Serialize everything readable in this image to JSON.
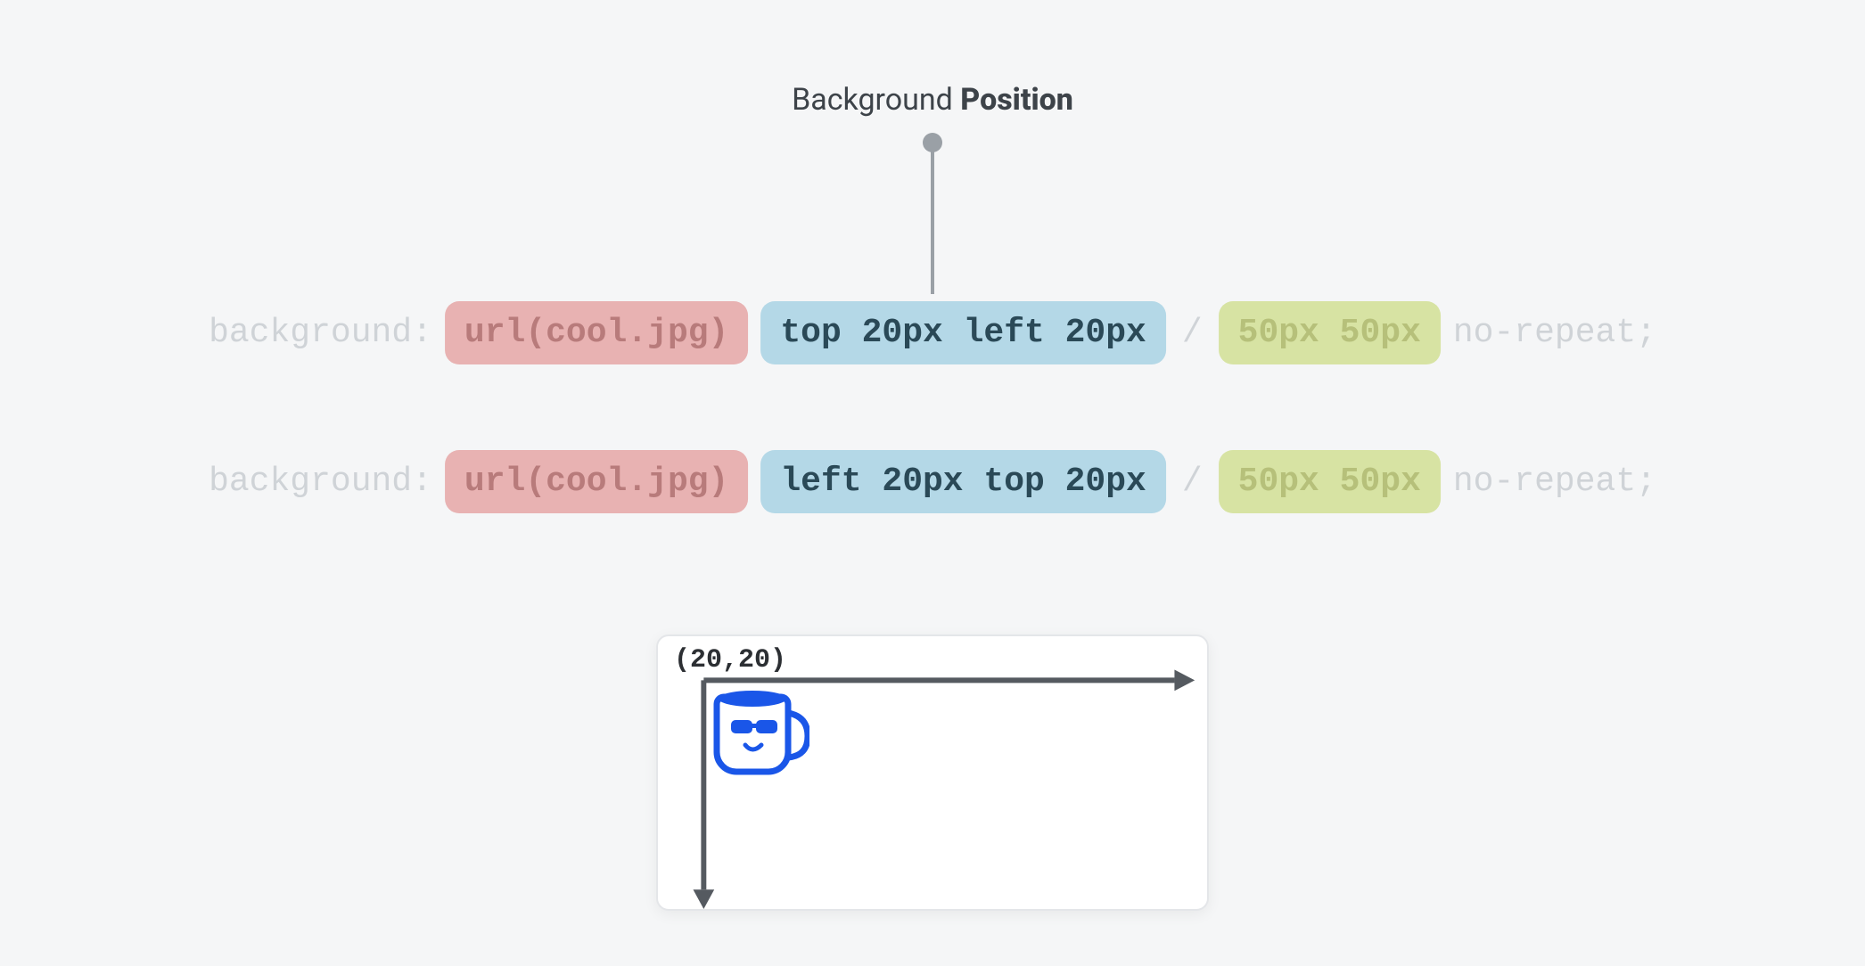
{
  "heading": {
    "light": "Background ",
    "bold": "Position"
  },
  "code": {
    "property": "background:",
    "url_token": "url(cool.jpg)",
    "position_line1": "top 20px left 20px",
    "position_line2": "left 20px top 20px",
    "slash": "/",
    "size_token": "50px 50px",
    "repeat_token": "no-repeat;"
  },
  "preview": {
    "coord_label": "(20,20)"
  },
  "colors": {
    "page_bg": "#f5f6f7",
    "pill_red_bg": "#e8b2b2",
    "pill_blue_bg": "#b4d8e7",
    "pill_green_bg": "#d7e3a3",
    "faded_text": "#cfd3d7",
    "heading_text": "#3d4349",
    "axis": "#555a60",
    "mug": "#1a56e8"
  }
}
